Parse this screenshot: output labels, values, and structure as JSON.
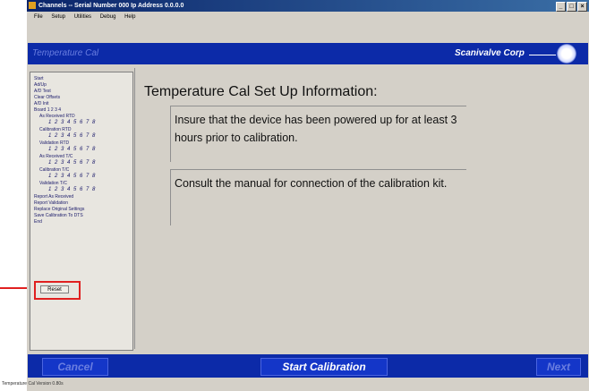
{
  "window": {
    "title": "Channels  -- Serial Number 000  Ip Address 0.0.0.0"
  },
  "menubar": {
    "items": [
      "File",
      "Setup",
      "Utilities",
      "Debug",
      "Help"
    ]
  },
  "header": {
    "app_title": "Temperature Cal",
    "brand": "Scanivalve Corp"
  },
  "sidebar": {
    "items": [
      {
        "label": "Start",
        "type": "item"
      },
      {
        "label": "Ad/Up",
        "type": "item"
      },
      {
        "label": "A/D Test",
        "type": "item"
      },
      {
        "label": "Clear Offsets",
        "type": "item"
      },
      {
        "label": "A/D Init",
        "type": "item"
      },
      {
        "label": "Board  1   2   3   4",
        "type": "item"
      },
      {
        "label": "As Received RTD",
        "type": "item"
      },
      {
        "label": "1 2 3 4 5 6 7 8",
        "type": "sub"
      },
      {
        "label": "Calibration RTD",
        "type": "item"
      },
      {
        "label": "1 2 3 4 5 6 7 8",
        "type": "sub"
      },
      {
        "label": "Validation RTD",
        "type": "item"
      },
      {
        "label": "1 2 3 4 5 6 7 8",
        "type": "sub"
      },
      {
        "label": "As Received T/C",
        "type": "item"
      },
      {
        "label": "1 2 3 4 5 6 7 8",
        "type": "sub"
      },
      {
        "label": "Calibration T/C",
        "type": "item"
      },
      {
        "label": "1 2 3 4 5 6 7 8",
        "type": "sub"
      },
      {
        "label": "Validation T/C",
        "type": "item"
      },
      {
        "label": "1 2 3 4 5 6 7 8",
        "type": "sub"
      },
      {
        "label": "Report As Received",
        "type": "item"
      },
      {
        "label": "Report Validation",
        "type": "item"
      },
      {
        "label": "Replace Original Settings",
        "type": "item"
      },
      {
        "label": "Save Calibration To DTS",
        "type": "item"
      },
      {
        "label": "End",
        "type": "item"
      }
    ],
    "reset_label": "Reset"
  },
  "main": {
    "heading": "Temperature Cal Set Up Information:",
    "note1": "Insure that the device has been powered up for at least 3 hours prior to calibration.",
    "note2": "Consult the manual for connection of the calibration kit."
  },
  "footer": {
    "cancel_label": "Cancel",
    "start_label": "Start Calibration",
    "next_label": "Next"
  },
  "status": {
    "text": "Temperature Cal Version 0.80s"
  },
  "colors": {
    "accent": "#0c2aa8",
    "highlight": "#e02020"
  }
}
